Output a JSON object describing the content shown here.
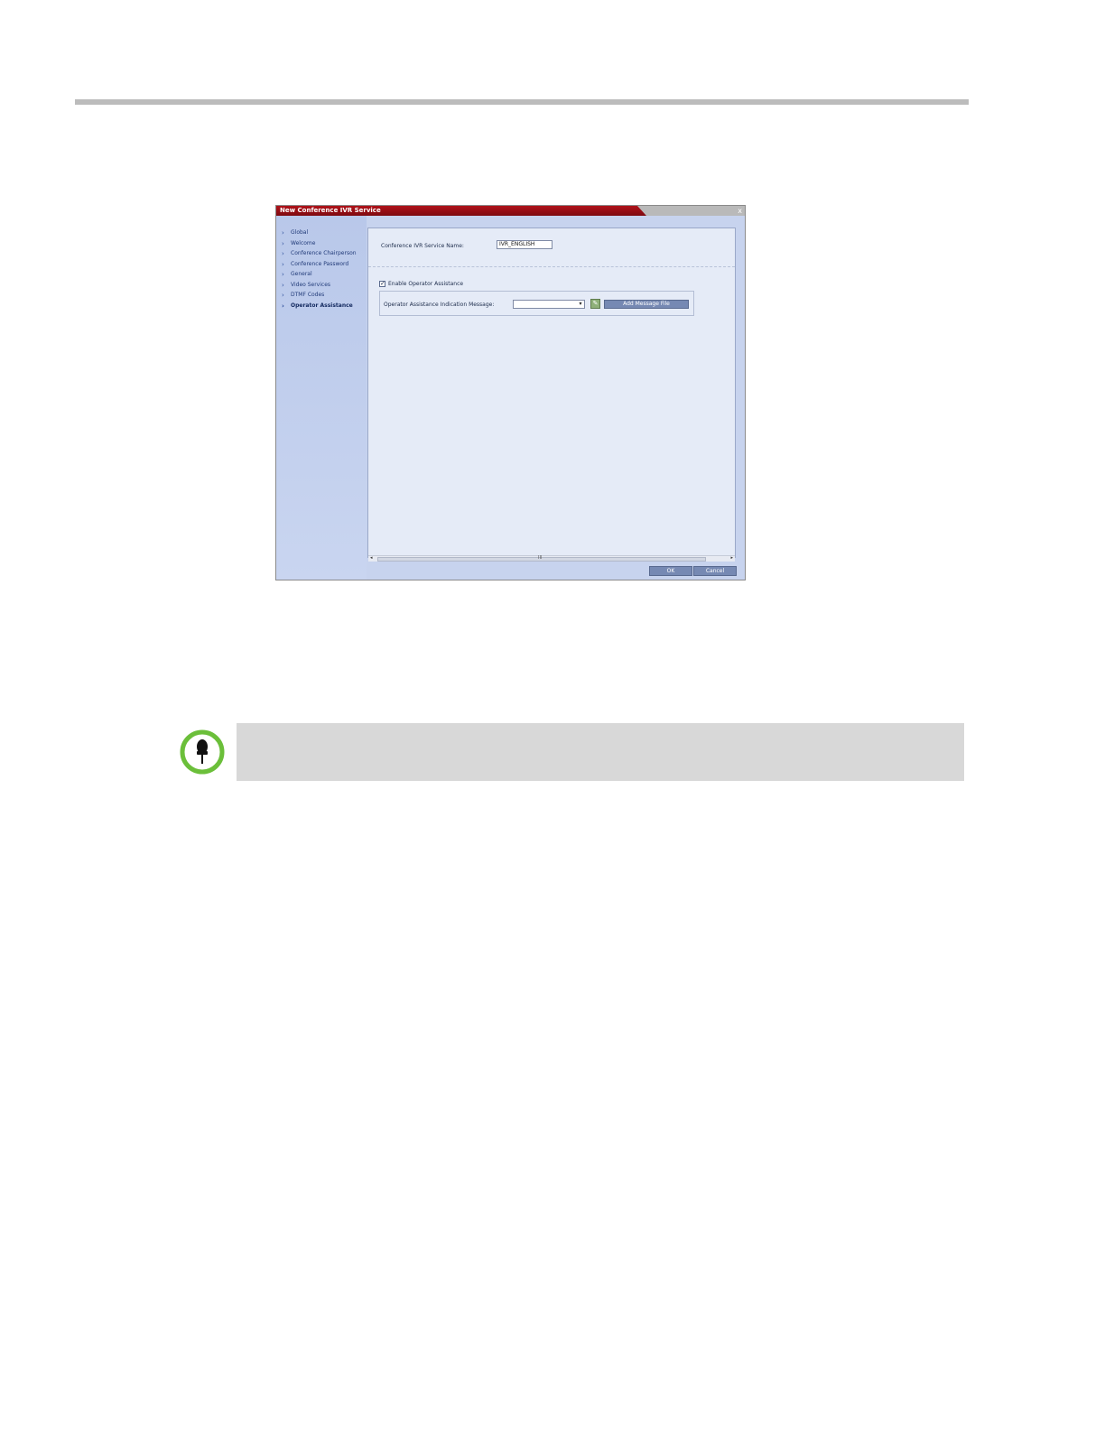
{
  "dialog": {
    "title": "New Conference IVR Service",
    "close_glyph": "x",
    "nav": [
      {
        "label": "Global"
      },
      {
        "label": "Welcome"
      },
      {
        "label": "Conference Chairperson"
      },
      {
        "label": "Conference Password"
      },
      {
        "label": "General"
      },
      {
        "label": "Video Services"
      },
      {
        "label": "DTMF Codes"
      },
      {
        "label": "Operator Assistance",
        "active": true
      }
    ],
    "service_name_label": "Conference IVR Service Name:",
    "service_name_value": "IVR_ENGLISH",
    "enable_operator_label": "Enable Operator Assistance",
    "enable_operator_checked": true,
    "indication_label": "Operator Assistance Indication Message:",
    "indication_value": "",
    "add_message_label": "Add Message File",
    "ok_label": "OK",
    "cancel_label": "Cancel",
    "scroll_grip": "III"
  },
  "note": {
    "icon": "pushpin-icon",
    "accent_color": "#6bbf3a"
  },
  "colors": {
    "title_red": "#a3111a",
    "sidebar": "#c7d3ee",
    "button": "#7689b3"
  }
}
